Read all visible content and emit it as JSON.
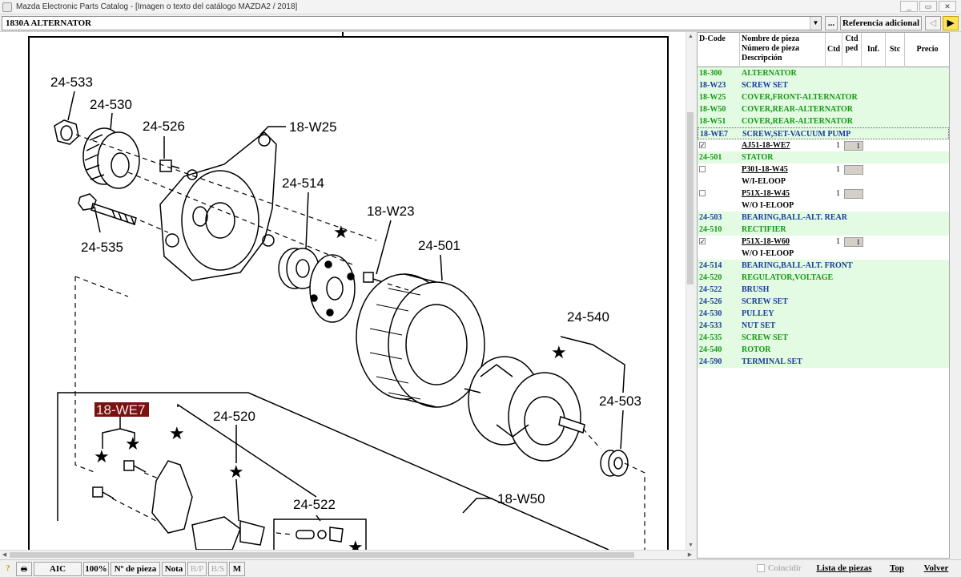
{
  "window": {
    "title": "Mazda Electronic Parts Catalog - [Imagen o texto del catálogo MAZDA2 / 2018]",
    "controls": [
      "_",
      "▭",
      "✕"
    ]
  },
  "toolbar": {
    "section_value": "1830A  ALTERNATOR",
    "dots_label": "...",
    "ref_label": "Referencia adicional",
    "back_label": "◁",
    "forward_label": "▶"
  },
  "diagram": {
    "callouts": [
      "24-533",
      "24-530",
      "24-526",
      "18-W25",
      "24-514",
      "18-W23",
      "24-501",
      "24-535",
      "24-540",
      "24-503",
      "18-WE7",
      "24-520",
      "24-522",
      "18-W50"
    ],
    "highlighted_callout": "18-WE7",
    "highlight_color": "#7a1010"
  },
  "parts_table": {
    "headers": {
      "code": "D-Code",
      "name_line1": "Nombre de pieza",
      "name_line2": "Número de pieza",
      "name_line3": "Descripción",
      "ctd": "Ctd",
      "ctd_ped_line1": "Ctd",
      "ctd_ped_line2": "ped",
      "inf": "Inf.",
      "stc": "Stc",
      "precio": "Precio"
    },
    "rows": [
      {
        "type": "part",
        "code": "18-300",
        "name": "ALTERNATOR",
        "color": "green"
      },
      {
        "type": "part",
        "code": "18-W23",
        "name": "SCREW SET",
        "color": "blue"
      },
      {
        "type": "part",
        "code": "18-W25",
        "name": "COVER,FRONT-ALTERNATOR",
        "color": "green"
      },
      {
        "type": "part",
        "code": "18-W50",
        "name": "COVER,REAR-ALTERNATOR",
        "color": "green"
      },
      {
        "type": "part",
        "code": "18-W51",
        "name": "COVER,REAR-ALTERNATOR",
        "color": "green"
      },
      {
        "type": "part",
        "code": "18-WE7",
        "name": "SCREW,SET-VACUUM PUMP",
        "color": "blue",
        "selected": true
      },
      {
        "type": "sub",
        "check": "✓",
        "pn": "AJ51-18-WE7",
        "qty": "1",
        "box": "1"
      },
      {
        "type": "part",
        "code": "24-501",
        "name": "STATOR",
        "color": "green"
      },
      {
        "type": "sub",
        "check": "",
        "pn": "P301-18-W45",
        "qty": "1",
        "box": ""
      },
      {
        "type": "desc",
        "text": "W/I-ELOOP"
      },
      {
        "type": "sub",
        "check": "",
        "pn": "P51X-18-W45",
        "qty": "1",
        "box": ""
      },
      {
        "type": "desc",
        "text": "W/O I-ELOOP"
      },
      {
        "type": "part",
        "code": "24-503",
        "name": "BEARING,BALL-ALT. REAR",
        "color": "blue"
      },
      {
        "type": "part",
        "code": "24-510",
        "name": "RECTIFIER",
        "color": "green"
      },
      {
        "type": "sub",
        "check": "✓",
        "pn": "P51X-18-W60",
        "qty": "1",
        "box": "1"
      },
      {
        "type": "desc",
        "text": "W/O I-ELOOP"
      },
      {
        "type": "part",
        "code": "24-514",
        "name": "BEARING,BALL-ALT. FRONT",
        "color": "blue"
      },
      {
        "type": "part",
        "code": "24-520",
        "name": "REGULATOR,VOLTAGE",
        "color": "green"
      },
      {
        "type": "part",
        "code": "24-522",
        "name": "BRUSH",
        "color": "blue"
      },
      {
        "type": "part",
        "code": "24-526",
        "name": "SCREW SET",
        "color": "blue"
      },
      {
        "type": "part",
        "code": "24-530",
        "name": "PULLEY",
        "color": "blue"
      },
      {
        "type": "part",
        "code": "24-533",
        "name": "NUT SET",
        "color": "blue"
      },
      {
        "type": "part",
        "code": "24-535",
        "name": "SCREW SET",
        "color": "green"
      },
      {
        "type": "part",
        "code": "24-540",
        "name": "ROTOR",
        "color": "green"
      },
      {
        "type": "part",
        "code": "24-590",
        "name": "TERMINAL SET",
        "color": "blue"
      }
    ]
  },
  "bottom": {
    "help": "?",
    "print": "🖶",
    "aic": "AIC",
    "zoom": "100%",
    "npieza": "Nº de pieza",
    "nota": "Nota",
    "bp": "B/P",
    "bs": "B/S",
    "m": "M",
    "coincidir": "Coincidir",
    "lista": "Lista de piezas",
    "top": "Top",
    "volver": "Volver"
  }
}
